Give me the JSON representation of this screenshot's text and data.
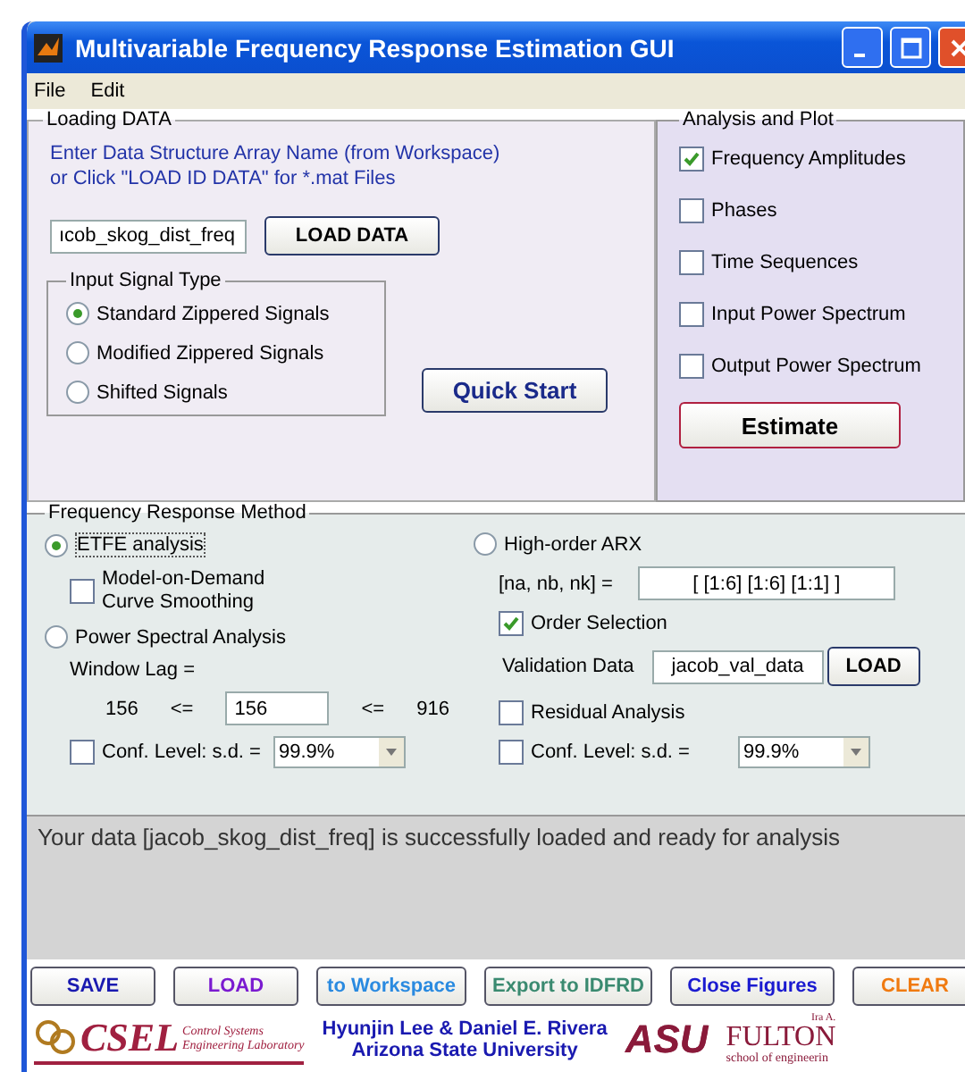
{
  "window": {
    "title": "Multivariable Frequency Response Estimation GUI"
  },
  "menu": [
    "File",
    "Edit"
  ],
  "loading": {
    "legend": "Loading DATA",
    "instructions": [
      "Enter Data Structure Array Name (from Workspace)",
      "or Click \"LOAD ID DATA\"   for  *.mat Files"
    ],
    "data_field": "ıcob_skog_dist_freq",
    "load_button": "LOAD DATA",
    "signal_type": {
      "legend": "Input Signal Type",
      "options": [
        {
          "label": "Standard Zippered Signals",
          "selected": true
        },
        {
          "label": "Modified Zippered Signals",
          "selected": false
        },
        {
          "label": "Shifted Signals",
          "selected": false
        }
      ]
    },
    "quick_start": "Quick Start"
  },
  "analysis": {
    "legend": "Analysis and Plot",
    "options": [
      {
        "label": "Frequency Amplitudes",
        "checked": true
      },
      {
        "label": "Phases",
        "checked": false
      },
      {
        "label": "Time Sequences",
        "checked": false
      },
      {
        "label": "Input Power Spectrum",
        "checked": false
      },
      {
        "label": "Output Power Spectrum",
        "checked": false
      }
    ],
    "estimate_button": "Estimate"
  },
  "method": {
    "legend": "Frequency Response Method",
    "etfe": {
      "label": "ETFE analysis",
      "selected": true,
      "smoothing": {
        "label": "Model-on-Demand Curve Smoothing",
        "checked": false
      }
    },
    "psa": {
      "label": "Power Spectral Analysis",
      "selected": false,
      "window_lag_label": "Window Lag =",
      "min": "156",
      "value": "156",
      "max": "916",
      "le": "<=",
      "conf": {
        "label": "Conf. Level: s.d. =",
        "checked": false,
        "value": "99.9%"
      }
    },
    "arx": {
      "label": "High-order ARX",
      "selected": false,
      "orders_label": "[na, nb, nk] =",
      "orders_value": "[ [1:6]  [1:6]  [1:1] ]",
      "order_selection": {
        "label": "Order Selection",
        "checked": true
      },
      "validation_label": "Validation Data",
      "validation_value": "jacob_val_data",
      "load_button": "LOAD",
      "residual": {
        "label": "Residual Analysis",
        "checked": false
      },
      "conf": {
        "label": "Conf. Level: s.d. =",
        "checked": false,
        "value": "99.9%"
      }
    }
  },
  "message": "Your data [jacob_skog_dist_freq] is successfully loaded and ready for analysis",
  "buttons": [
    {
      "label": "SAVE",
      "color": "#1a1ab0"
    },
    {
      "label": "LOAD",
      "color": "#7a1ad0"
    },
    {
      "label": "to Workspace",
      "color": "#2a8ae0"
    },
    {
      "label": "Export to IDFRD",
      "color": "#3a8a70"
    },
    {
      "label": "Close Figures",
      "color": "#1a1ad0"
    },
    {
      "label": "CLEAR",
      "color": "#f07a10"
    }
  ],
  "footer": {
    "csel": {
      "name": "CSEL",
      "subtitle": [
        "Control Systems",
        "Engineering Laboratory"
      ]
    },
    "credits": [
      "Hyunjin Lee & Daniel E. Rivera",
      "Arizona State University"
    ],
    "asu": "ASU",
    "fulton": {
      "pre": "Ira A.",
      "name": "FULTON",
      "subtitle": "school of engineerin"
    }
  }
}
